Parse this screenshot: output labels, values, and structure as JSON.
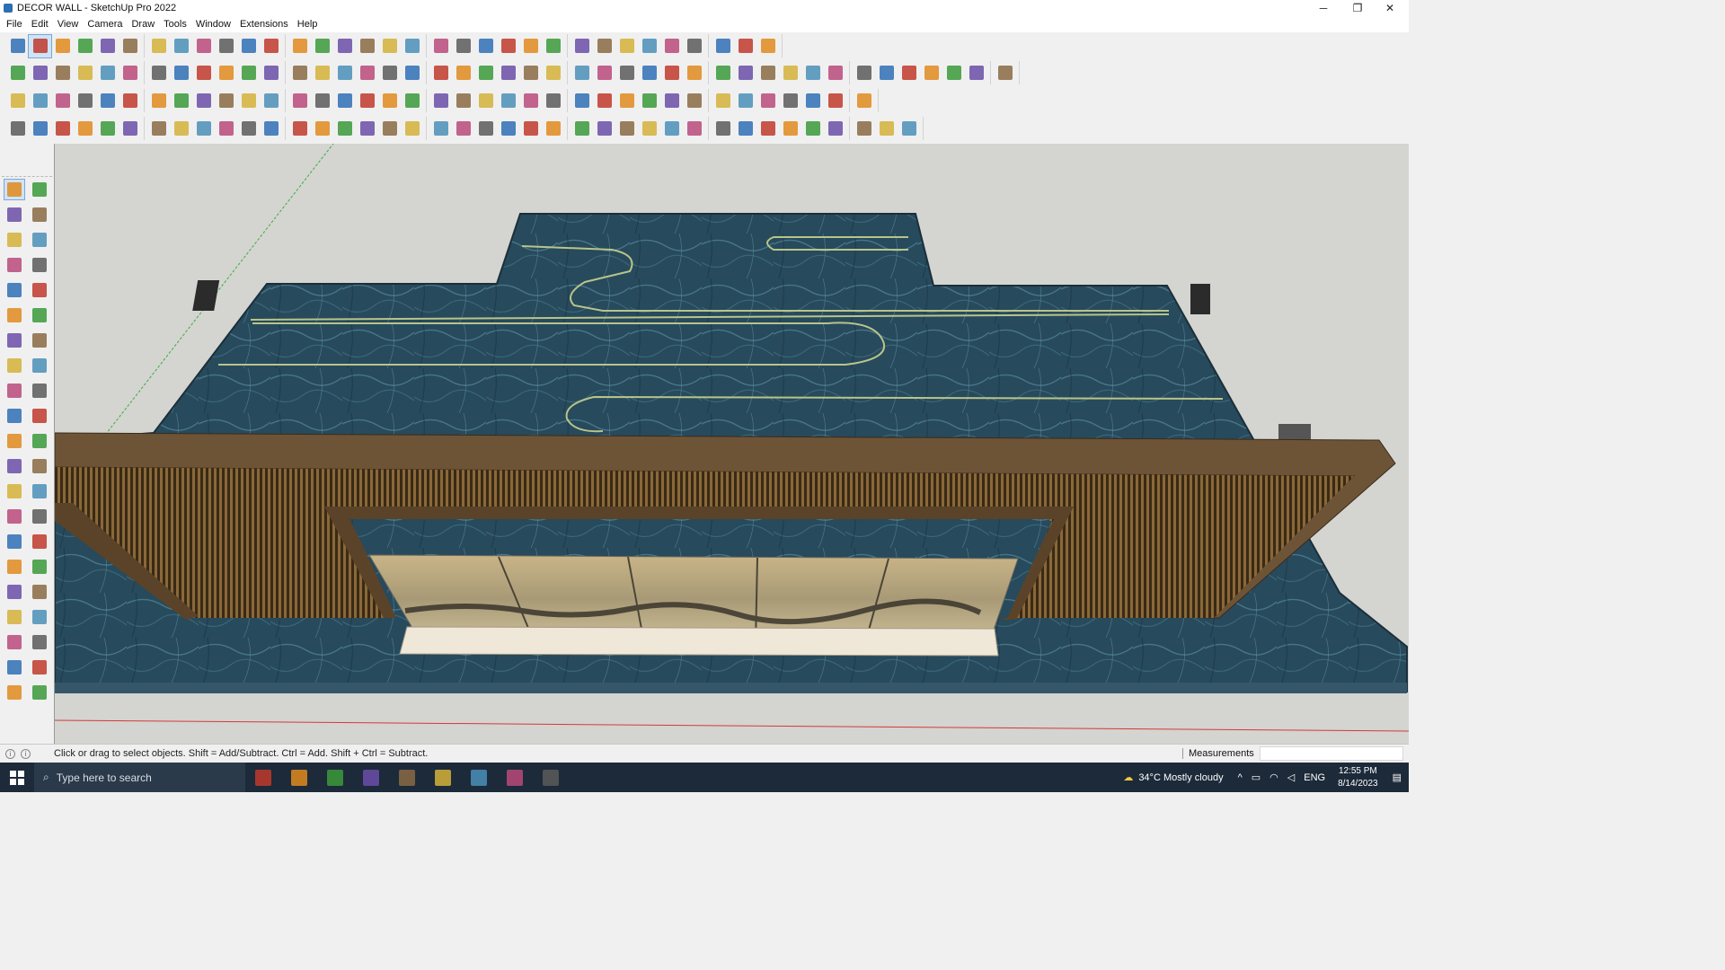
{
  "window": {
    "title": "DECOR WALL - SketchUp Pro 2022",
    "minimize_glyph": "─",
    "restore_glyph": "❐",
    "close_glyph": "✕"
  },
  "menu": [
    "File",
    "Edit",
    "View",
    "Camera",
    "Draw",
    "Tools",
    "Window",
    "Extensions",
    "Help"
  ],
  "toolbars": {
    "row1": [
      "zoom-extents-icon",
      "select-icon",
      "eraser-icon",
      "pencil-icon",
      "freehand-icon",
      "rectangle-icon",
      "push-pull-icon",
      "follow-me-icon",
      "move-icon",
      "rotate-icon",
      "scale-icon",
      "tape-measure-icon",
      "text-icon",
      "paint-bucket-icon",
      "orbit-icon",
      "pan-icon",
      "zoom-icon",
      "zoom-window-icon",
      "components-icon",
      "sandbox-icon",
      "layers-icon",
      "section-icon",
      "profile-icon",
      "extension-warehouse-icon",
      "3d-warehouse-icon",
      "solid-tools-icon",
      "up-arrow-icon",
      "down-arrow-icon",
      "axes-icon",
      "shadows-icon",
      "undo-icon",
      "redo-icon",
      "reset-icon"
    ],
    "row2": [
      "iso-view-icon",
      "top-view-icon",
      "front-view-icon",
      "right-view-icon",
      "back-view-icon",
      "left-view-icon",
      "bottom-view-icon",
      "push-icon",
      "pull-icon",
      "flip-icon",
      "arc-icon",
      "section-plane-icon",
      "section-cut-icon",
      "section-fill-icon",
      "surface-icon",
      "terrain-icon",
      "house-icon",
      "roof-icon",
      "gable-icon",
      "garage-icon",
      "porch-icon",
      "font-icon",
      "leaf-icon",
      "pen-icon",
      "shape-square-icon",
      "shape-circle-icon",
      "shape-hexagon-icon",
      "shape-ellipse-icon",
      "shape-parallelogram-icon",
      "shape-arc-icon",
      "shape-spiral-icon",
      "shape-path-icon",
      "shape-curve-icon",
      "shape-loop-icon",
      "measure-icon",
      "tag-icon",
      "material-icon",
      "grid-icon",
      "brick-icon",
      "texture-icon",
      "roof-tile-icon",
      "render-icon",
      "export-icon"
    ],
    "row3": [
      "solid-blue-icon",
      "plane-blue-icon",
      "plane-yellow-icon",
      "text-label-icon",
      "curve-orange-icon",
      "rect-red-icon",
      "list-icon",
      "door-icon",
      "wood-icon",
      "connector-icon",
      "stairs-icon",
      "polyline-icon",
      "cross-red-icon",
      "cross-green-icon",
      "cross-blue-icon",
      "cone-icon",
      "tree-icon",
      "triangle-icon",
      "lasso-icon",
      "lasso-red-icon",
      "lasso-dark-icon",
      "snap-icon",
      "box-icon",
      "rotate-red-icon",
      "green-grid-icon",
      "copy-icon",
      "array-icon",
      "flip-red-icon",
      "bulb-icon",
      "group-icon",
      "frame-icon",
      "tile-icon",
      "tile-alt-icon",
      "tile-grid-icon",
      "close-x-icon",
      "bezier-icon",
      "align-icon"
    ],
    "row4": [
      "draw-arc-icon",
      "curve-dots-icon",
      "car-icon",
      "ruby-icon",
      "line-a-icon",
      "line-b-icon",
      "pipe-icon",
      "box-3d-icon",
      "sphere-icon",
      "slice-icon",
      "corner-icon",
      "angle-icon",
      "dimension-icon",
      "bend-icon",
      "chair-icon",
      "lamp-icon",
      "rail-icon",
      "spring-icon",
      "hand-icon",
      "leaf2-icon",
      "plane2-icon",
      "stairs2-icon",
      "stripe-a-icon",
      "stripe-b-icon",
      "stripe-c-icon",
      "stripe-d-icon",
      "barrel-icon",
      "hatch-icon",
      "bracket-icon",
      "bracket-b-icon",
      "fence-icon",
      "weave-icon",
      "lines-icon",
      "comb-icon",
      "ring-icon",
      "gear-icon",
      "ramp-icon",
      "wave-icon",
      "hex-icon"
    ]
  },
  "palette": [
    "select-icon",
    "orbit-icon",
    "paint-bucket-icon",
    "eraser-icon",
    "components-icon",
    "tape-measure-icon",
    "line-icon",
    "freehand-icon",
    "rectangle-icon",
    "rotated-rectangle-icon",
    "circle-icon",
    "polygon-icon",
    "arc-icon",
    "two-point-arc-icon",
    "three-point-arc-icon",
    "pie-icon",
    "move-icon",
    "push-pull-icon",
    "rotate-icon",
    "follow-me-icon",
    "scale-icon",
    "offset-icon",
    "tape-icon",
    "text-icon",
    "protractor-icon",
    "3d-text-icon",
    "axes-icon",
    "dimension-icon",
    "orbit-b-icon",
    "pan-icon",
    "zoom-icon",
    "zoom-window-icon",
    "zoom-extents-icon",
    "previous-view-icon",
    "position-camera-icon",
    "look-around-icon",
    "walk-icon",
    "section-plane-icon",
    "warehouse-icon",
    "sandbox-icon",
    "layers-icon",
    "terrain-icon"
  ],
  "scene": {
    "model": "decor-wall",
    "surface_color": "#274a5c",
    "frame_color": "#6e5437",
    "panel_color": "#b99d72"
  },
  "status": {
    "hint": "Click or drag to select objects. Shift = Add/Subtract. Ctrl = Add. Shift + Ctrl = Subtract.",
    "measurements_label": "Measurements",
    "measurements_value": ""
  },
  "taskbar": {
    "search_placeholder": "Type here to search",
    "apps": [
      "people-icon",
      "task-view-icon",
      "calculator-icon",
      "file-explorer-icon",
      "acrobat-icon",
      "3dsmax-icon",
      "edge-icon",
      "sticky-notes-icon",
      "sketchup-icon"
    ],
    "weather": "34°C  Mostly cloudy",
    "language": "ENG",
    "time": "12:55 PM",
    "date": "8/14/2023"
  }
}
